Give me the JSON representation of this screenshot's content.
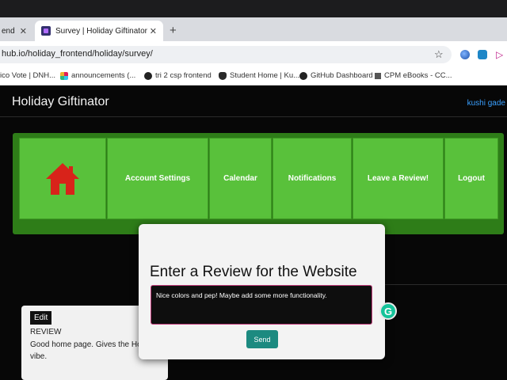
{
  "browser": {
    "tabs": [
      {
        "label": "end"
      },
      {
        "label": "Survey | Holiday Giftinator"
      }
    ],
    "url": "hub.io/holiday_frontend/holiday/survey/",
    "bookmarks": [
      {
        "label": "ico Vote | DNH..."
      },
      {
        "label": "announcements (..."
      },
      {
        "label": "tri 2 csp frontend"
      },
      {
        "label": "Student Home | Ku..."
      },
      {
        "label": "GitHub Dashboard"
      },
      {
        "label": "CPM eBooks - CC..."
      }
    ]
  },
  "site": {
    "title": "Holiday Giftinator",
    "user": "kushi gade"
  },
  "nav": {
    "home_icon": "house-icon",
    "items": [
      {
        "label": "Account Settings"
      },
      {
        "label": "Calendar"
      },
      {
        "label": "Notifications"
      },
      {
        "label": "Leave a Review!"
      },
      {
        "label": "Logout"
      }
    ]
  },
  "modal": {
    "title": "Enter a Review for the Website",
    "review_value": "Nice colors and pep! Maybe add some more functionality.",
    "send_label": "Send"
  },
  "review_card": {
    "edit_label": "Edit",
    "heading": "REVIEW",
    "text": "Good home page. Gives the Holiday vibe."
  },
  "colors": {
    "nav_green": "#59c13b",
    "nav_dark_green": "#2e7d18",
    "send_teal": "#1c8a80",
    "user_link_blue": "#3aa0ff",
    "home_red": "#d8231a"
  }
}
